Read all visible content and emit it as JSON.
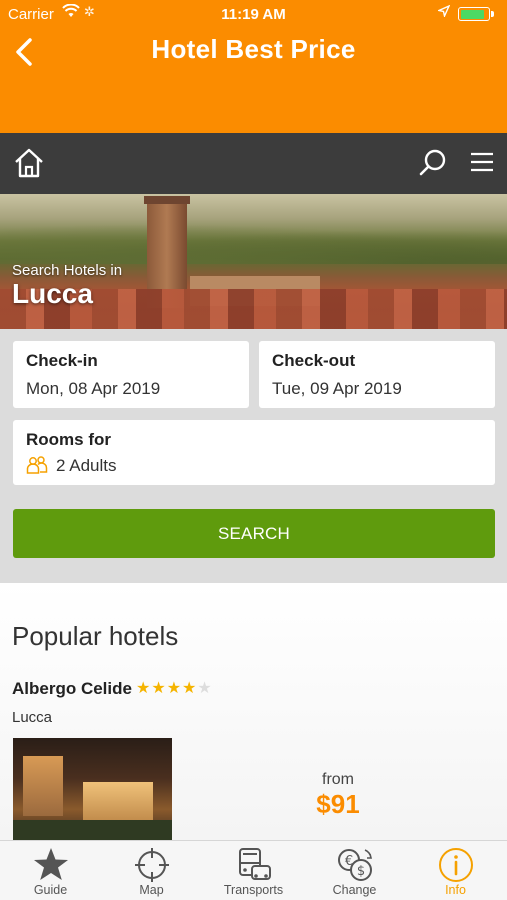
{
  "status_bar": {
    "carrier": "Carrier",
    "time": "11:19 AM",
    "battery_level": 0.9
  },
  "header": {
    "title": "Hotel Best Price",
    "back_icon": "back-chevron-icon"
  },
  "navbar": {
    "home_icon": "home-icon",
    "search_icon": "search-icon",
    "menu_icon": "hamburger-menu-icon"
  },
  "hero": {
    "subtitle": "Search Hotels in",
    "city": "Lucca"
  },
  "form": {
    "checkin": {
      "label": "Check-in",
      "value": "Mon, 08 Apr 2019"
    },
    "checkout": {
      "label": "Check-out",
      "value": "Tue, 09 Apr 2019"
    },
    "rooms": {
      "label": "Rooms for",
      "value": "2 Adults",
      "icon": "people-icon"
    },
    "search_label": "SEARCH"
  },
  "popular": {
    "heading": "Popular hotels",
    "hotels": [
      {
        "name": "Albergo Celide",
        "stars": 4,
        "max_stars": 5,
        "city": "Lucca",
        "from_label": "from",
        "price": "$91"
      }
    ]
  },
  "tabs": [
    {
      "label": "Guide",
      "icon": "star-icon",
      "active": false
    },
    {
      "label": "Map",
      "icon": "crosshair-icon",
      "active": false
    },
    {
      "label": "Transports",
      "icon": "bus-icon",
      "active": false
    },
    {
      "label": "Change",
      "icon": "currency-exchange-icon",
      "active": false
    },
    {
      "label": "Info",
      "icon": "info-icon",
      "active": true
    }
  ],
  "colors": {
    "accent": "#fb8c00",
    "navbar": "#3c3c3c",
    "search_button": "#5f9b0d",
    "star": "#f5b400",
    "active_tab": "#f5a100"
  }
}
